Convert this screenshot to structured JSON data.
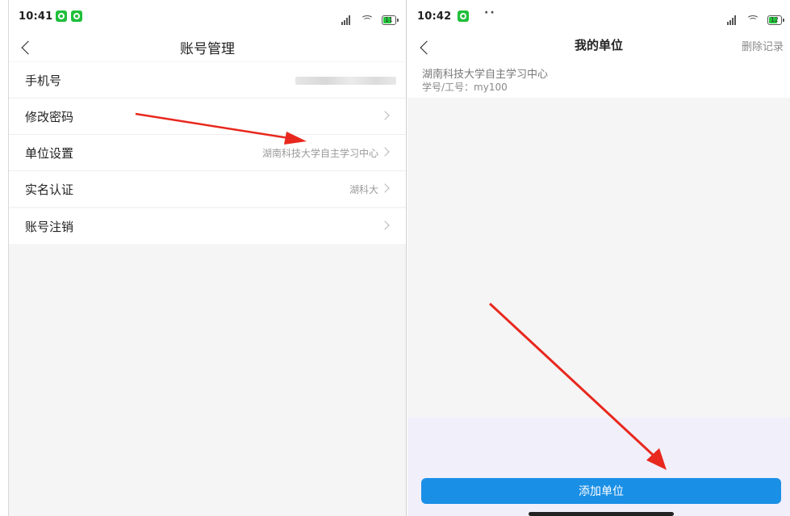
{
  "left_screen": {
    "status": {
      "time": "10:41",
      "battery": "11"
    },
    "nav": {
      "title": "账号管理"
    },
    "rows": [
      {
        "label": "手机号",
        "value": ""
      },
      {
        "label": "修改密码",
        "value": ""
      },
      {
        "label": "单位设置",
        "value": "湖南科技大学自主学习中心"
      },
      {
        "label": "实名认证",
        "value": "湖科大"
      }
    ],
    "section2": [
      {
        "label": "账号注销"
      }
    ]
  },
  "right_screen": {
    "status": {
      "time": "10:42",
      "dots": "··",
      "battery": "12"
    },
    "nav": {
      "title": "我的单位",
      "action": "删除记录"
    },
    "unit": {
      "name": "湖南科技大学自主学习中心",
      "id": "学号/工号：my100"
    },
    "add_button": "添加单位"
  },
  "colors": {
    "accent": "#1a8fe6",
    "annotation_arrow": "#e8281e",
    "status_app_icon": "#1fbf3a"
  }
}
